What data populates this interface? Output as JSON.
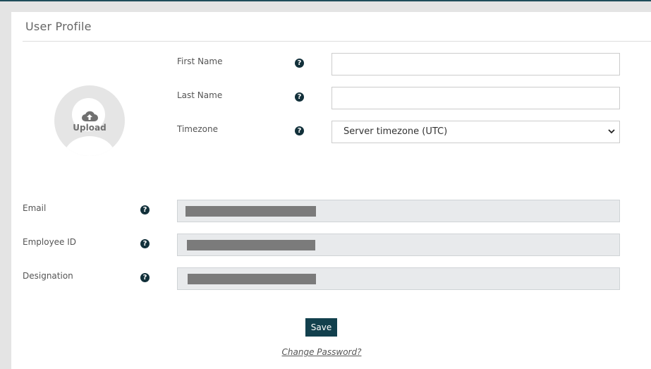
{
  "title": "User Profile",
  "avatar": {
    "upload_label": "Upload",
    "icon": "cloud-upload-icon"
  },
  "help_glyph": "?",
  "fields": {
    "first_name": {
      "label": "First Name",
      "value": ""
    },
    "last_name": {
      "label": "Last Name",
      "value": ""
    },
    "timezone": {
      "label": "Timezone",
      "selected": "Server timezone (UTC)"
    },
    "email": {
      "label": "Email"
    },
    "employee_id": {
      "label": "Employee ID"
    },
    "designation": {
      "label": "Designation"
    }
  },
  "actions": {
    "save_label": "Save",
    "change_password_label": "Change Password?"
  },
  "colors": {
    "accent": "#12404d",
    "readonly_bg": "#e8eaec",
    "page_bg": "#e4e4e4"
  }
}
